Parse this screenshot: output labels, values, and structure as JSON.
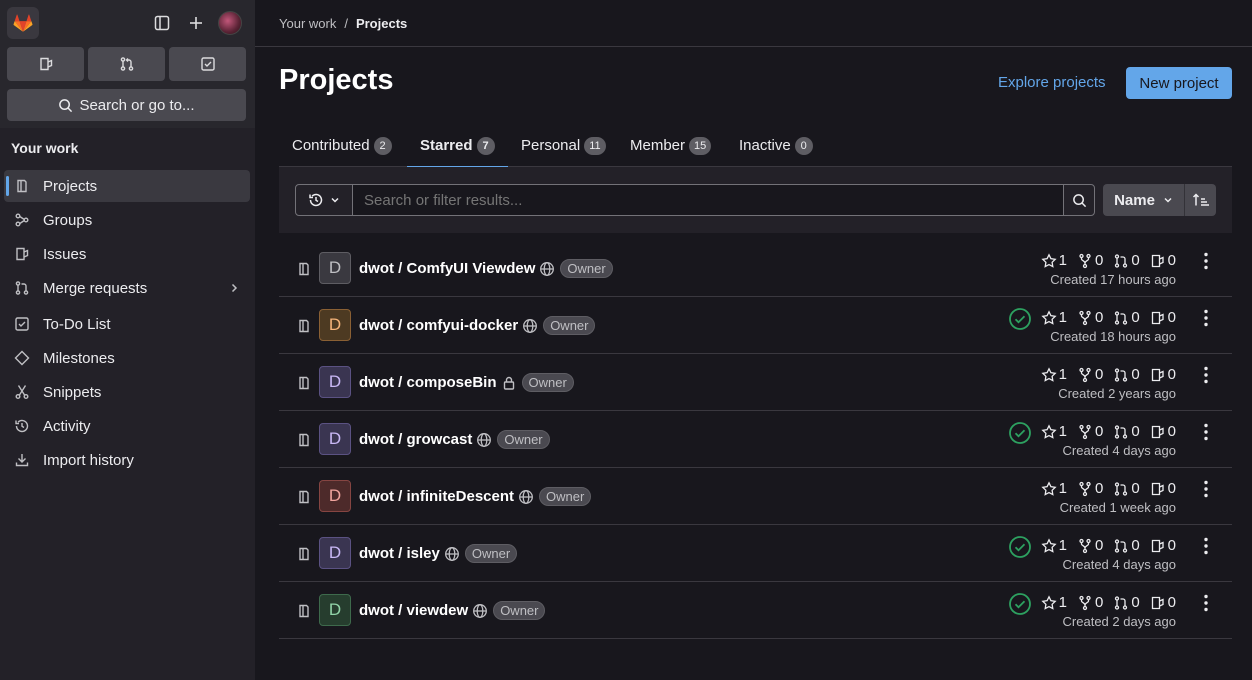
{
  "colors": {
    "accent": "#63a6e9",
    "success": "#2da160",
    "sidebar_bg": "#232128",
    "page_bg": "#18171d"
  },
  "sidebar": {
    "search_label": "Search or go to...",
    "section_title": "Your work",
    "items": [
      {
        "label": "Projects",
        "icon": "project-icon"
      },
      {
        "label": "Groups",
        "icon": "group-icon"
      },
      {
        "label": "Issues",
        "icon": "issues-icon"
      },
      {
        "label": "Merge requests",
        "icon": "merge-request-icon"
      },
      {
        "label": "To-Do List",
        "icon": "todo-icon"
      },
      {
        "label": "Milestones",
        "icon": "milestone-icon"
      },
      {
        "label": "Snippets",
        "icon": "snippet-icon"
      },
      {
        "label": "Activity",
        "icon": "history-icon"
      },
      {
        "label": "Import history",
        "icon": "import-icon"
      }
    ]
  },
  "breadcrumb": {
    "parent": "Your work",
    "separator": "/",
    "current": "Projects"
  },
  "header": {
    "title": "Projects",
    "explore_label": "Explore projects",
    "new_label": "New project"
  },
  "tabs": [
    {
      "label": "Contributed",
      "count": "2"
    },
    {
      "label": "Starred",
      "count": "7"
    },
    {
      "label": "Personal",
      "count": "11"
    },
    {
      "label": "Member",
      "count": "15"
    },
    {
      "label": "Inactive",
      "count": "0"
    }
  ],
  "filter": {
    "placeholder": "Search or filter results...",
    "sort_label": "Name"
  },
  "projects": [
    {
      "initial": "D",
      "name": "dwot / ComfyUI Viewdew",
      "visibility": "public",
      "role": "Owner",
      "pipeline": false,
      "stars": "1",
      "forks": "0",
      "mrs": "0",
      "issues": "0",
      "created": "Created 17 hours ago"
    },
    {
      "initial": "D",
      "name": "dwot / comfyui-docker",
      "visibility": "public",
      "role": "Owner",
      "pipeline": true,
      "stars": "1",
      "forks": "0",
      "mrs": "0",
      "issues": "0",
      "created": "Created 18 hours ago"
    },
    {
      "initial": "D",
      "name": "dwot / composeBin",
      "visibility": "private",
      "role": "Owner",
      "pipeline": false,
      "stars": "1",
      "forks": "0",
      "mrs": "0",
      "issues": "0",
      "created": "Created 2 years ago"
    },
    {
      "initial": "D",
      "name": "dwot / growcast",
      "visibility": "public",
      "role": "Owner",
      "pipeline": true,
      "stars": "1",
      "forks": "0",
      "mrs": "0",
      "issues": "0",
      "created": "Created 4 days ago"
    },
    {
      "initial": "D",
      "name": "dwot / infiniteDescent",
      "visibility": "public",
      "role": "Owner",
      "pipeline": false,
      "stars": "1",
      "forks": "0",
      "mrs": "0",
      "issues": "0",
      "created": "Created 1 week ago"
    },
    {
      "initial": "D",
      "name": "dwot / isley",
      "visibility": "public",
      "role": "Owner",
      "pipeline": true,
      "stars": "1",
      "forks": "0",
      "mrs": "0",
      "issues": "0",
      "created": "Created 4 days ago"
    },
    {
      "initial": "D",
      "name": "dwot / viewdew",
      "visibility": "public",
      "role": "Owner",
      "pipeline": true,
      "stars": "1",
      "forks": "0",
      "mrs": "0",
      "issues": "0",
      "created": "Created 2 days ago"
    }
  ]
}
